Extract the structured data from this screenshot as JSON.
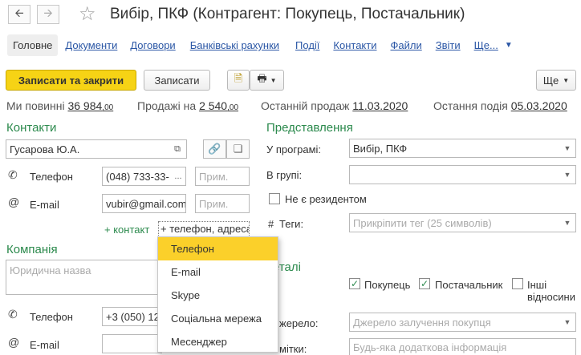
{
  "header": {
    "back_icon": "arrow-left-icon",
    "forward_icon": "arrow-right-icon",
    "favorite_icon": "star-outline-icon",
    "title": "Вибір, ПКФ (Контрагент: Покупець, Постачальник)"
  },
  "tabs": [
    {
      "label": "Головне",
      "active": true
    },
    {
      "label": "Документи"
    },
    {
      "label": "Договори"
    },
    {
      "label": "Банківські рахунки"
    },
    {
      "label": "Події"
    },
    {
      "label": "Контакти"
    },
    {
      "label": "Файли"
    },
    {
      "label": "Звіти"
    },
    {
      "label": "Ще..."
    }
  ],
  "toolbar": {
    "save_close_label": "Записати та закрити",
    "save_label": "Записати",
    "more_label": "Ще"
  },
  "stats": {
    "owe_label": "Ми повинні",
    "owe_main": "36 984",
    "owe_cents": ",00",
    "sales_label": "Продажі на",
    "sales_main": "2 540",
    "sales_cents": ",00",
    "last_sale_label": "Останній продаж",
    "last_sale_date": "11.03.2020",
    "last_event_label": "Остання подія",
    "last_event_date": "05.03.2020"
  },
  "contacts": {
    "section_title": "Контакти",
    "contact_name": "Гусарова Ю.А.",
    "phone_label": "Телефон",
    "phone_value": "(048) 733-33-",
    "note_placeholder": "Прим.",
    "email_label": "E-mail",
    "email_value": "vubir@gmail.com",
    "add_contact_link": "+ контакт",
    "add_phone_link": "+ телефон, адреса"
  },
  "dropdown": {
    "items": [
      "Телефон",
      "E-mail",
      "Skype",
      "Соціальна мережа",
      "Месенджер"
    ],
    "selected_index": 0
  },
  "company": {
    "section_title": "Компанія",
    "legal_name_placeholder": "Юридична назва",
    "phone_label": "Телефон",
    "phone_value": "+3 (050) 12",
    "email_label": "E-mail"
  },
  "representation": {
    "section_title": "Представлення",
    "program_label": "У програмі:",
    "program_value": "Вибір, ПКФ",
    "group_label": "В групі:",
    "nonresident_label": "Не є резидентом",
    "tags_label": "Теги:",
    "tags_placeholder": "Прикріпити тег (25 символів)"
  },
  "details": {
    "section_title_visible": "еталі",
    "buyer_label": "Покупець",
    "supplier_label": "Постачальник",
    "other_label_1": "Інші",
    "other_label_2": "відносини",
    "source_label": "жерело:",
    "source_placeholder": "Джерело залучення покупця",
    "notes_label": "мітки:",
    "notes_placeholder": "Будь-яка додаткова інформація"
  },
  "colors": {
    "accent_yellow": "#f6d315",
    "section_green": "#2c8a4d",
    "link_blue": "#2a56a5",
    "selected_item": "#fbd02a"
  }
}
